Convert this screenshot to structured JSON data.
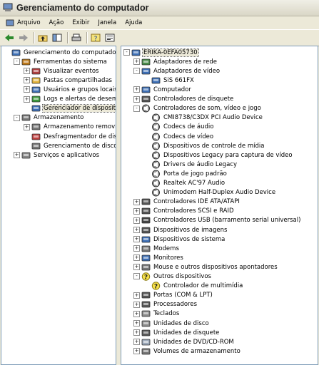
{
  "window": {
    "title": "Gerenciamento do computador"
  },
  "menu": [
    "Arquivo",
    "Ação",
    "Exibir",
    "Janela",
    "Ajuda"
  ],
  "tree": [
    {
      "label": "Gerenciamento do computador (local",
      "icon": "computer-management-icon",
      "depth": 0,
      "expander": "none"
    },
    {
      "label": "Ferramentas do sistema",
      "icon": "tools-icon",
      "depth": 1,
      "expander": "-"
    },
    {
      "label": "Visualizar eventos",
      "icon": "event-viewer-icon",
      "depth": 2,
      "expander": "+"
    },
    {
      "label": "Pastas compartilhadas",
      "icon": "shared-folder-icon",
      "depth": 2,
      "expander": "+"
    },
    {
      "label": "Usuários e grupos locais",
      "icon": "users-icon",
      "depth": 2,
      "expander": "+"
    },
    {
      "label": "Logs e alertas de desempent",
      "icon": "performance-logs-icon",
      "depth": 2,
      "expander": "+"
    },
    {
      "label": "Gerenciador de dispositivos",
      "icon": "device-manager-icon",
      "depth": 2,
      "expander": "none",
      "selected": true
    },
    {
      "label": "Armazenamento",
      "icon": "storage-icon",
      "depth": 1,
      "expander": "-"
    },
    {
      "label": "Armazenamento removível",
      "icon": "removable-storage-icon",
      "depth": 2,
      "expander": "+"
    },
    {
      "label": "Desfragmentador de disco",
      "icon": "defrag-icon",
      "depth": 2,
      "expander": "none"
    },
    {
      "label": "Gerenciamento de disco",
      "icon": "disk-management-icon",
      "depth": 2,
      "expander": "none"
    },
    {
      "label": "Serviços e aplicativos",
      "icon": "services-icon",
      "depth": 1,
      "expander": "+"
    }
  ],
  "devices": [
    {
      "label": "ERIKA-0EFA05730",
      "icon": "computer-icon",
      "depth": 0,
      "expander": "-",
      "selected": true
    },
    {
      "label": "Adaptadores de rede",
      "icon": "network-adapter-icon",
      "depth": 1,
      "expander": "+"
    },
    {
      "label": "Adaptadores de vídeo",
      "icon": "display-adapter-icon",
      "depth": 1,
      "expander": "-"
    },
    {
      "label": "SiS 661FX",
      "icon": "display-adapter-icon",
      "depth": 2,
      "expander": "none"
    },
    {
      "label": "Computador",
      "icon": "computer-icon",
      "depth": 1,
      "expander": "+"
    },
    {
      "label": "Controladores de disquete",
      "icon": "floppy-controller-icon",
      "depth": 1,
      "expander": "+"
    },
    {
      "label": "Controladores de som, vídeo e jogo",
      "icon": "sound-icon",
      "depth": 1,
      "expander": "-"
    },
    {
      "label": "CMI8738/C3DX PCI Audio Device",
      "icon": "sound-icon",
      "depth": 2,
      "expander": "none"
    },
    {
      "label": "Codecs de áudio",
      "icon": "sound-icon",
      "depth": 2,
      "expander": "none"
    },
    {
      "label": "Codecs de vídeo",
      "icon": "sound-icon",
      "depth": 2,
      "expander": "none"
    },
    {
      "label": "Dispositivos de controle de mídia",
      "icon": "sound-icon",
      "depth": 2,
      "expander": "none"
    },
    {
      "label": "Dispositivos Legacy para captura de vídeo",
      "icon": "sound-icon",
      "depth": 2,
      "expander": "none"
    },
    {
      "label": "Drivers de áudio Legacy",
      "icon": "sound-icon",
      "depth": 2,
      "expander": "none"
    },
    {
      "label": "Porta de jogo padrão",
      "icon": "sound-icon",
      "depth": 2,
      "expander": "none"
    },
    {
      "label": "Realtek AC'97 Audio",
      "icon": "sound-icon",
      "depth": 2,
      "expander": "none"
    },
    {
      "label": "Unimodem Half-Duplex Audio Device",
      "icon": "sound-icon",
      "depth": 2,
      "expander": "none"
    },
    {
      "label": "Controladores IDE ATA/ATAPI",
      "icon": "ide-controller-icon",
      "depth": 1,
      "expander": "+"
    },
    {
      "label": "Controladores SCSI e RAID",
      "icon": "scsi-controller-icon",
      "depth": 1,
      "expander": "+"
    },
    {
      "label": "Controladores USB (barramento serial universal)",
      "icon": "usb-icon",
      "depth": 1,
      "expander": "+"
    },
    {
      "label": "Dispositivos de imagens",
      "icon": "imaging-device-icon",
      "depth": 1,
      "expander": "+"
    },
    {
      "label": "Dispositivos de sistema",
      "icon": "system-device-icon",
      "depth": 1,
      "expander": "+"
    },
    {
      "label": "Modems",
      "icon": "modem-icon",
      "depth": 1,
      "expander": "+"
    },
    {
      "label": "Monitores",
      "icon": "monitor-icon",
      "depth": 1,
      "expander": "+"
    },
    {
      "label": "Mouse e outros dispositivos apontadores",
      "icon": "mouse-icon",
      "depth": 1,
      "expander": "+"
    },
    {
      "label": "Outros dispositivos",
      "icon": "unknown-device-icon",
      "depth": 1,
      "expander": "-"
    },
    {
      "label": "Controlador de multimídia",
      "icon": "unknown-device-icon",
      "depth": 2,
      "expander": "none"
    },
    {
      "label": "Portas (COM & LPT)",
      "icon": "port-icon",
      "depth": 1,
      "expander": "+"
    },
    {
      "label": "Processadores",
      "icon": "processor-icon",
      "depth": 1,
      "expander": "+"
    },
    {
      "label": "Teclados",
      "icon": "keyboard-icon",
      "depth": 1,
      "expander": "+"
    },
    {
      "label": "Unidades de disco",
      "icon": "disk-drive-icon",
      "depth": 1,
      "expander": "+"
    },
    {
      "label": "Unidades de disquete",
      "icon": "floppy-drive-icon",
      "depth": 1,
      "expander": "+"
    },
    {
      "label": "Unidades de DVD/CD-ROM",
      "icon": "cdrom-icon",
      "depth": 1,
      "expander": "+"
    },
    {
      "label": "Volumes de armazenamento",
      "icon": "storage-volume-icon",
      "depth": 1,
      "expander": "+"
    }
  ]
}
